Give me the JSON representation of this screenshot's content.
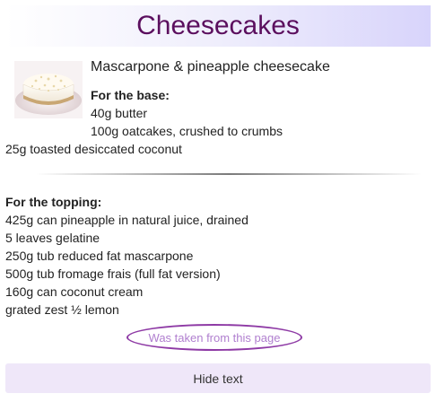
{
  "header": {
    "title": "Cheesecakes"
  },
  "recipe": {
    "title": "Mascarpone & pineapple cheesecake",
    "image_icon": "cheesecake-photo",
    "base": {
      "heading": "For the base:",
      "items": [
        "40g butter",
        "100g oatcakes, crushed to crumbs",
        "25g toasted desiccated coconut"
      ]
    },
    "topping": {
      "heading": "For the topping:",
      "items": [
        "425g can pineapple in natural juice, drained",
        "5 leaves gelatine",
        "250g tub reduced fat mascarpone",
        "500g tub fromage frais (full fat version)",
        "160g can coconut cream",
        "grated zest ½ lemon"
      ]
    }
  },
  "source_link": {
    "label": "Was taken from this page"
  },
  "hide_button": {
    "label": "Hide text"
  },
  "colors": {
    "title": "#5b0f5e",
    "link": "#b07fcf",
    "link_oval": "#8e3aa5",
    "button_bg": "#efe7f9"
  }
}
